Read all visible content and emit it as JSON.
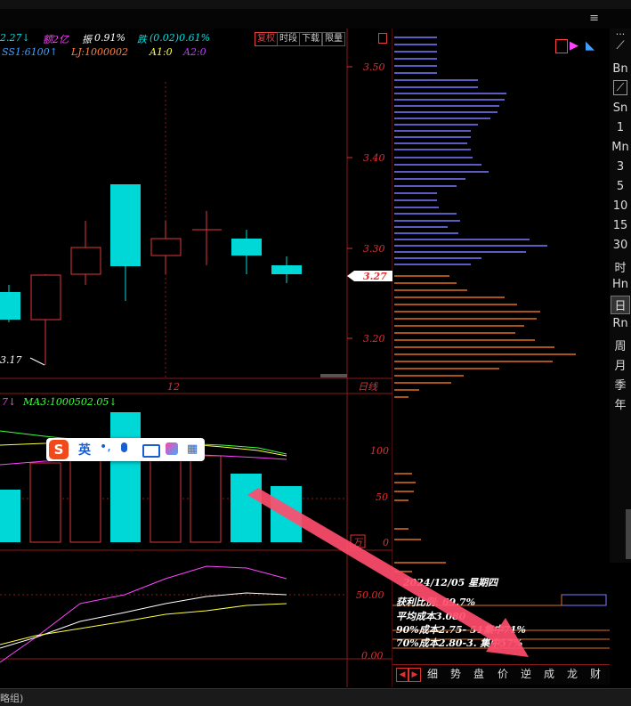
{
  "header": {
    "price_fragment": "2.27↓",
    "volume": "额2亿",
    "amplitude_label": "振",
    "amplitude_value": "0.91%",
    "change_label": "跌",
    "change_value": "(0.02)0.61%",
    "buttons": [
      "复权",
      "时段",
      "下载",
      "限量"
    ],
    "line2_ss1": "SS1:6100↑",
    "line2_lj": "LJ:1000002",
    "line2_a1": "A1:0",
    "line2_a2": "A2:0"
  },
  "price_axis": {
    "labels": [
      "3.50",
      "3.40",
      "3.30",
      "3.20"
    ],
    "current_price": "3.27",
    "period": "日线"
  },
  "main_chart": {
    "low_label": "3.17",
    "date_label": "12"
  },
  "volume_panel": {
    "header_fragment": "7↓",
    "ma3": "MA3:1000502.05↓",
    "axis": [
      "100",
      "50",
      "0"
    ],
    "unit": "万"
  },
  "indicator_panel": {
    "axis": [
      "50.00",
      "0.00"
    ]
  },
  "info_panel": {
    "date_line": "2024/12/05 星期四",
    "profit_line": "获利比例:   69.7%",
    "avg_cost": "平均成本3.080",
    "cost90": "90%成本2.75-     51集中71%",
    "cost70": "70%成本2.80-3.   集中57%"
  },
  "tabs": [
    "细",
    "势",
    "盘",
    "价",
    "逆",
    "成",
    "龙",
    "财"
  ],
  "sidebar": {
    "items": [
      "Bn",
      "Sn",
      "1",
      "Mn",
      "3",
      "5",
      "10",
      "15",
      "30",
      "时",
      "Hn",
      "日",
      "Rn",
      "周",
      "月",
      "季",
      "年"
    ],
    "active": "日"
  },
  "ime": {
    "lang": "英",
    "logo": "S"
  },
  "statusbar": {
    "text": "略组)"
  },
  "colors": {
    "up": "#e0393e",
    "down": "#00d8d8",
    "grid": "#8b1a1a",
    "axis_text": "#e03030",
    "chip_upper": "#7a7aff",
    "chip_lower": "#e07020",
    "arrow": "#ff4d6d"
  }
}
